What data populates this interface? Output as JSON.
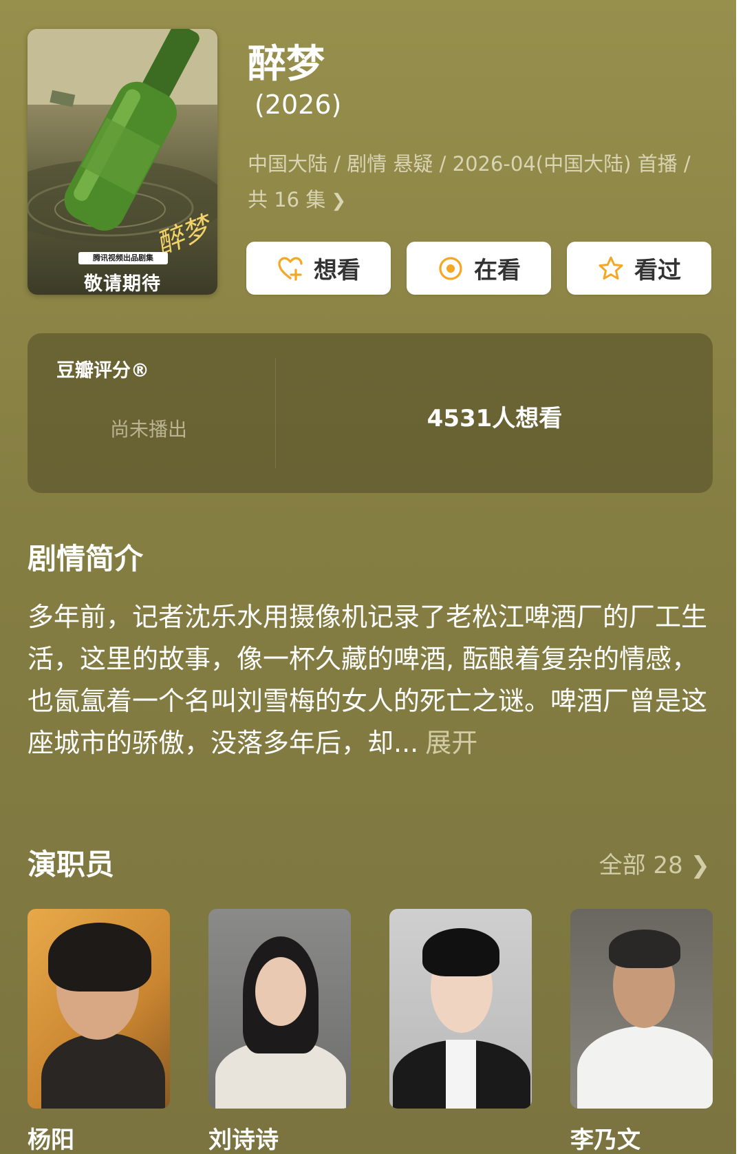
{
  "show": {
    "title": "醉梦",
    "year": "(2026)",
    "meta_line1": "中国大陆 / 剧情 悬疑 / 2026-04(中国大陆) 首播 /",
    "meta_line2": "共 16 集"
  },
  "poster": {
    "badge": "腾讯视频出品剧集",
    "tagline": "敬请期待",
    "script_text": "醉梦"
  },
  "actions": [
    {
      "label": "想看",
      "icon": "heart-plus-icon"
    },
    {
      "label": "在看",
      "icon": "circle-dot-icon"
    },
    {
      "label": "看过",
      "icon": "star-icon"
    }
  ],
  "rating": {
    "label": "豆瓣评分®",
    "value": "尚未播出",
    "want_count": "4531人想看"
  },
  "synopsis": {
    "title": "剧情简介",
    "text": "多年前，记者沈乐水用摄像机记录了老松江啤酒厂的厂工生活，这里的故事，像一杯久藏的啤酒, 酝酿着复杂的情感，也氤氲着一个名叫刘雪梅的女人的死亡之谜。啤酒厂曾是这座城市的骄傲，没落多年后，却...",
    "expand": "展开"
  },
  "cast": {
    "title": "演职员",
    "all_label": "全部 28",
    "members": [
      {
        "name": "杨阳"
      },
      {
        "name": "刘诗诗"
      },
      {
        "name": ""
      },
      {
        "name": "李乃文"
      }
    ]
  },
  "colors": {
    "background": "#857e42",
    "accent": "#f5a623",
    "card": "#ffffff"
  }
}
